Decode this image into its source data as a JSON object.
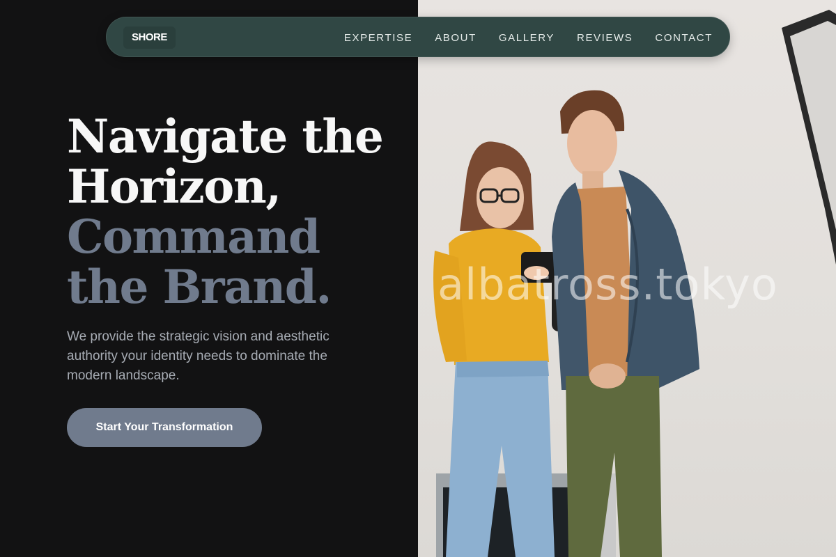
{
  "brand": {
    "logo_text": "SHORE"
  },
  "nav": {
    "items": [
      {
        "label": "EXPERTISE"
      },
      {
        "label": "ABOUT"
      },
      {
        "label": "GALLERY"
      },
      {
        "label": "REVIEWS"
      },
      {
        "label": "CONTACT"
      }
    ]
  },
  "hero": {
    "headline_lines": [
      "Navigate the",
      "Horizon,",
      "Command",
      "the Brand."
    ],
    "subtext": "We provide the strategic vision and aesthetic authority your identity needs to dominate the modern landscape.",
    "cta_label": "Start Your Transformation"
  },
  "photo": {
    "watermark": "albatross.tokyo"
  },
  "colors": {
    "background": "#121213",
    "navbar": "#304744",
    "headline_light": "#f7f7f7",
    "headline_muted": "#707b8d",
    "cta_bg": "#707b8d",
    "subtext": "#a7acb4"
  }
}
